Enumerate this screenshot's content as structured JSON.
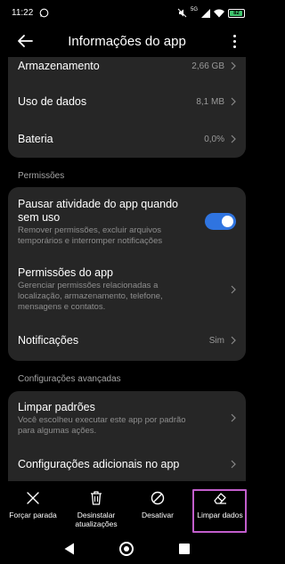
{
  "status_bar": {
    "time": "11:22",
    "battery": "82",
    "network": "5G"
  },
  "header": {
    "title": "Informações do app"
  },
  "card_storage": {
    "rows": [
      {
        "title": "Armazenamento",
        "value": "2,66 GB"
      },
      {
        "title": "Uso de dados",
        "value": "8,1 MB"
      },
      {
        "title": "Bateria",
        "value": "0,0%"
      }
    ]
  },
  "permissions": {
    "section_label": "Permissões",
    "pause": {
      "title_line1": "Pausar atividade do app quando",
      "title_line2": "sem uso",
      "desc_line1": "Remover permissões, excluir arquivos",
      "desc_line2": "temporários e interromper notificações",
      "enabled": true
    },
    "app_permissions": {
      "title": "Permissões do app",
      "desc_line1": "Gerenciar permissões relacionadas a",
      "desc_line2": "localização, armazenamento, telefone,",
      "desc_line3": "mensagens e contatos."
    },
    "notifications": {
      "title": "Notificações",
      "value": "Sim"
    }
  },
  "advanced": {
    "section_label": "Configurações avançadas",
    "clear_defaults": {
      "title": "Limpar padrões",
      "desc_line1": "Você escolheu executar este app por padrão",
      "desc_line2": "para algumas ações."
    },
    "additional": {
      "title": "Configurações adicionais no app"
    }
  },
  "actions": {
    "force_stop": "Forçar parada",
    "uninstall_line1": "Desinstalar",
    "uninstall_line2": "atualizações",
    "disable": "Desativar",
    "clear_data": "Limpar dados"
  },
  "colors": {
    "background": "#000000",
    "card": "#262626",
    "accent": "#2f74e0",
    "highlight": "#c25ecc"
  }
}
